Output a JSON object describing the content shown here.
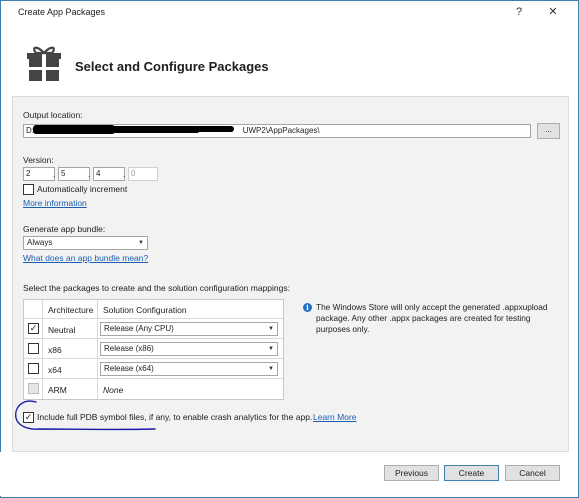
{
  "window": {
    "title": "Create App Packages",
    "help": "?",
    "close": "✕"
  },
  "header": {
    "title": "Select and Configure Packages",
    "icon": "gift-icon"
  },
  "output": {
    "label": "Output location:",
    "path_start": "D:\\",
    "path_end": "UWP2\\AppPackages\\",
    "browse": "..."
  },
  "version": {
    "label": "Version:",
    "parts": [
      "2",
      "5",
      "4",
      "0"
    ],
    "sep": ".",
    "auto_increment_label": "Automatically increment",
    "auto_increment_checked": false,
    "more_info": "More information"
  },
  "bundle": {
    "label": "Generate app bundle:",
    "selected": "Always",
    "link": "What does an app bundle mean?"
  },
  "packages": {
    "label": "Select the packages to create and the solution configuration mappings:",
    "headers": [
      "Architecture",
      "Solution Configuration"
    ],
    "rows": [
      {
        "arch": "Neutral",
        "config": "Release (Any CPU)",
        "checked": true,
        "enabled": true
      },
      {
        "arch": "x86",
        "config": "Release (x86)",
        "checked": false,
        "enabled": true
      },
      {
        "arch": "x64",
        "config": "Release (x64)",
        "checked": false,
        "enabled": true
      },
      {
        "arch": "ARM",
        "config": "None",
        "checked": false,
        "enabled": false
      }
    ]
  },
  "info": {
    "icon": "info-icon",
    "text": "The Windows Store will only accept the generated .appxupload package. Any other .appx packages are created for testing purposes only."
  },
  "pdb": {
    "label": "Include full PDB symbol files, if any, to enable crash analytics for the app.",
    "link": "Learn More",
    "checked": true
  },
  "buttons": {
    "previous": "Previous",
    "create": "Create",
    "cancel": "Cancel"
  },
  "colors": {
    "accent": "#1f6fc5",
    "annotation": "#1a1aa8"
  }
}
